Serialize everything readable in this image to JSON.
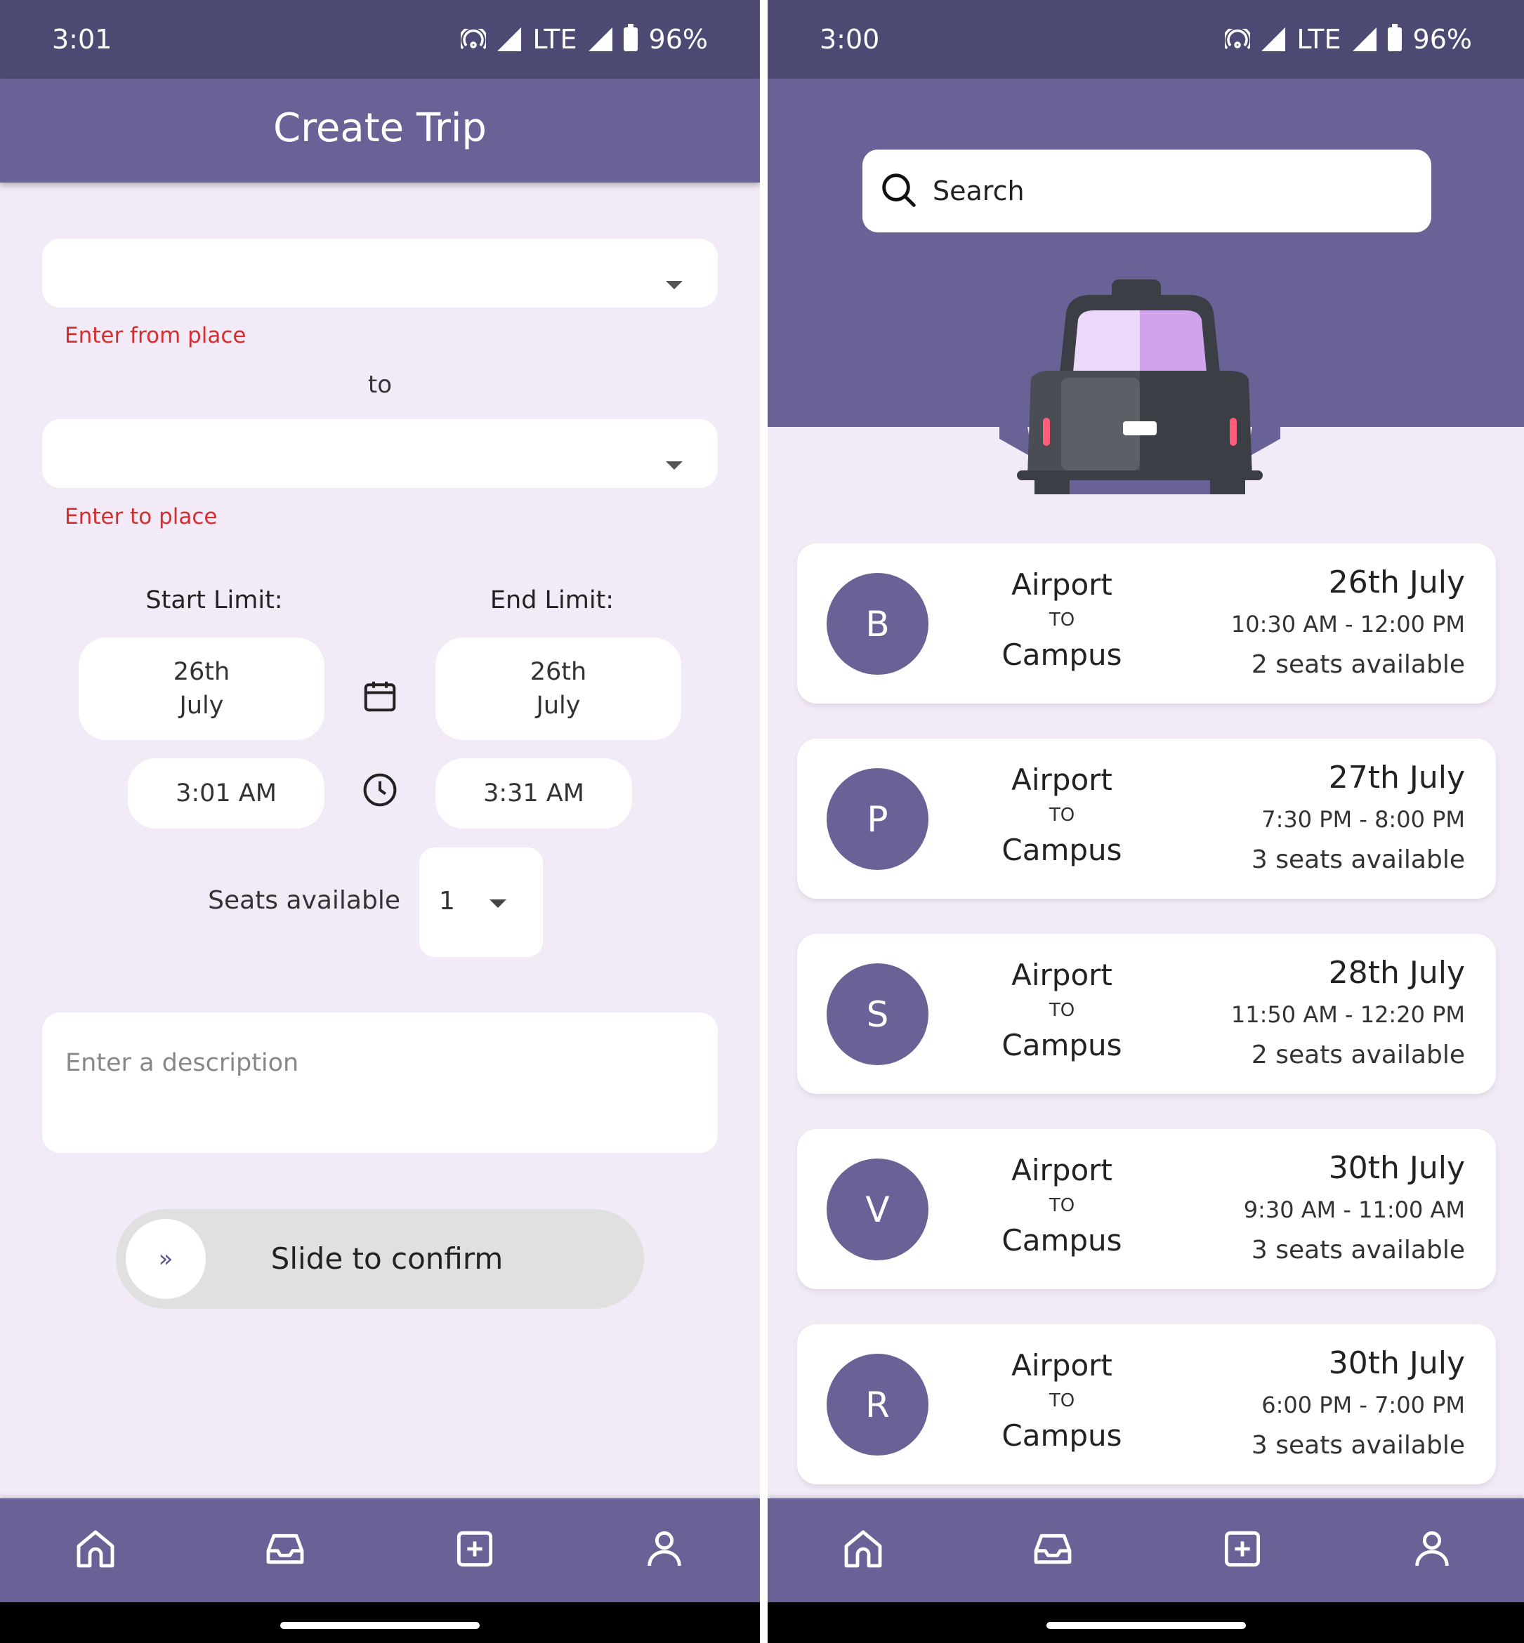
{
  "left_screen": {
    "status": {
      "time": "3:01",
      "network": "LTE",
      "battery": "96%"
    },
    "title": "Create Trip",
    "from_field": {
      "value": "",
      "error": "Enter from place"
    },
    "to_label": "to",
    "to_field": {
      "value": "",
      "error": "Enter to place"
    },
    "start_limit": {
      "label": "Start Limit:",
      "date_day": "26th",
      "date_month": "July",
      "time": "3:01 AM"
    },
    "end_limit": {
      "label": "End Limit:",
      "date_day": "26th",
      "date_month": "July",
      "time": "3:31 AM"
    },
    "seats": {
      "label": "Seats available",
      "value": "1"
    },
    "description_placeholder": "Enter a description",
    "slider": {
      "label": "Slide to confirm",
      "knob_glyph": "»"
    }
  },
  "right_screen": {
    "status": {
      "time": "3:00",
      "network": "LTE",
      "battery": "96%"
    },
    "search_placeholder": "Search",
    "trips": [
      {
        "initial": "B",
        "from": "Airport",
        "to_word": "TO",
        "to": "Campus",
        "date": "26th July",
        "time": "10:30 AM - 12:00 PM",
        "seats": "2 seats available"
      },
      {
        "initial": "P",
        "from": "Airport",
        "to_word": "TO",
        "to": "Campus",
        "date": "27th July",
        "time": "7:30 PM - 8:00 PM",
        "seats": "3 seats available"
      },
      {
        "initial": "S",
        "from": "Airport",
        "to_word": "TO",
        "to": "Campus",
        "date": "28th July",
        "time": "11:50 AM - 12:20 PM",
        "seats": "2 seats available"
      },
      {
        "initial": "V",
        "from": "Airport",
        "to_word": "TO",
        "to": "Campus",
        "date": "30th July",
        "time": "9:30 AM - 11:00 AM",
        "seats": "3 seats available"
      },
      {
        "initial": "R",
        "from": "Airport",
        "to_word": "TO",
        "to": "Campus",
        "date": "30th July",
        "time": "6:00 PM - 7:00 PM",
        "seats": "3 seats available"
      }
    ]
  },
  "nav_icons": [
    "home-icon",
    "inbox-icon",
    "add-square-icon",
    "person-icon"
  ],
  "colors": {
    "primary": "#686296",
    "status_bar": "#4c4a73",
    "background": "#f2eaf6",
    "error": "#d32f2f"
  }
}
